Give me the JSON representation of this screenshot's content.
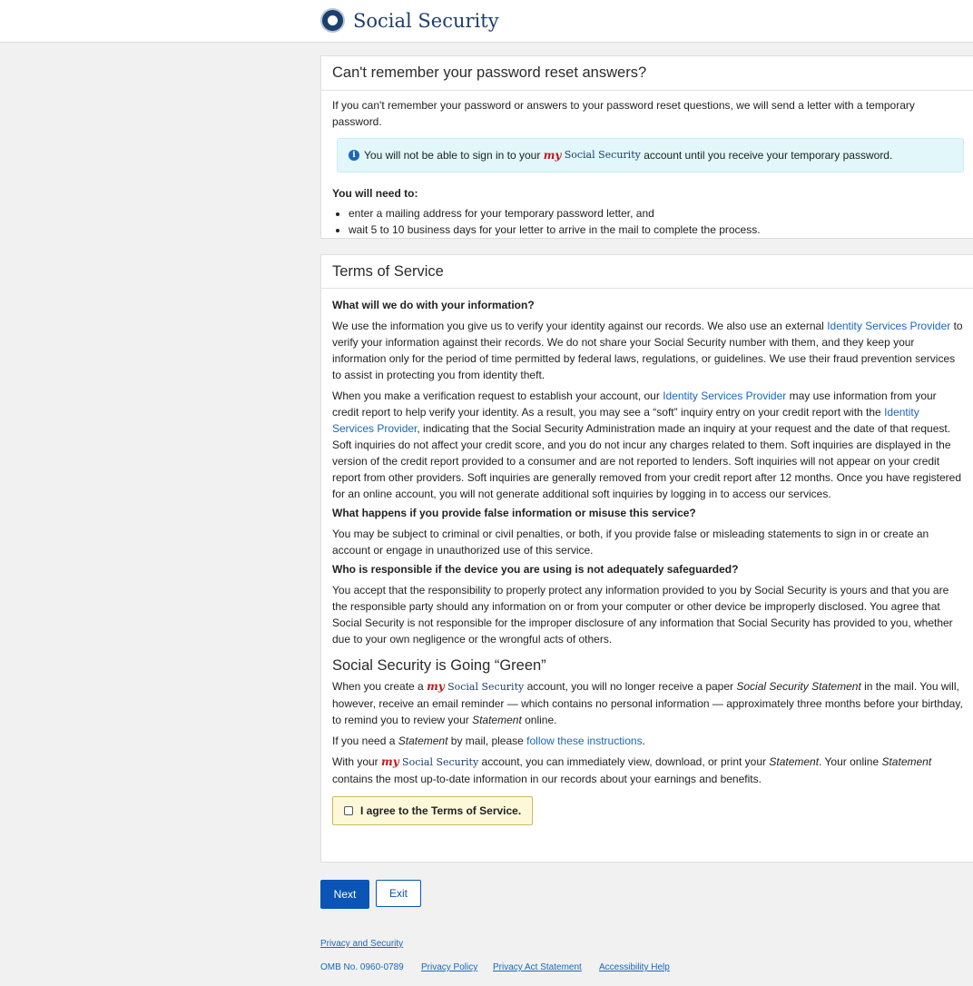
{
  "header": {
    "brand": "Social Security"
  },
  "reset_panel": {
    "title": "Can't remember your password reset answers?",
    "intro": "If you can't remember your password or answers to your password reset questions, we will send a letter with a temporary password.",
    "alert": {
      "before": "You will not be able to sign in to your",
      "my": "my",
      "ss": "Social Security",
      "after": "account until you receive your temporary password."
    },
    "need_heading": "You will need to:",
    "needs": [
      "enter a mailing address for your temporary password letter, and",
      "wait 5 to 10 business days for your letter to arrive in the mail to complete the process."
    ]
  },
  "terms_panel": {
    "title": "Terms of Service",
    "q1": "What will we do with your information?",
    "p1_a": "We use the information you give us to verify your identity against our records. We also use an external",
    "p1_link": "Identity Services Provider",
    "p1_b": "to verify your information against their records. We do not share your Social Security number with them, and they keep your information only for the period of time permitted by federal laws, regulations, or guidelines. We use their fraud prevention services to assist in protecting you from identity theft.",
    "p2_a": "When you make a verification request to establish your account, our",
    "p2_link1": "Identity Services Provider",
    "p2_b": "may use information from your credit report to help verify your identity. As a result, you may see a “soft” inquiry entry on your credit report with the",
    "p2_link2": "Identity Services Provider",
    "p2_c": ", indicating that the Social Security Administration made an inquiry at your request and the date of that request. Soft inquiries do not affect your credit score, and you do not incur any charges related to them. Soft inquiries are displayed in the version of the credit report provided to a consumer and are not reported to lenders. Soft inquiries will not appear on your credit report from other providers. Soft inquiries are generally removed from your credit report after 12 months. Once you have registered for an online account, you will not generate additional soft inquiries by logging in to access our services.",
    "q2": "What happens if you provide false information or misuse this service?",
    "p3": "You may be subject to criminal or civil penalties, or both, if you provide false or misleading statements to sign in or create an account or engage in unauthorized use of this service.",
    "q3": "Who is responsible if the device you are using is not adequately safeguarded?",
    "p4": "You accept that the responsibility to properly protect any information provided to you by Social Security is yours and that you are the responsible party should any information on or from your computer or other device be improperly disclosed. You agree that Social Security is not responsible for the improper disclosure of any information that Social Security has provided to you, whether due to your own negligence or the wrongful acts of others.",
    "green_title": "Social Security is Going “Green”",
    "g1_a": "When you create a",
    "my": "my",
    "ss": "Social Security",
    "g1_b": "account, you will no longer receive a paper",
    "g1_statement": "Social Security Statement",
    "g1_c": "in the mail. You will, however, receive an email reminder — which contains no personal information — approximately three months before your birthday, to remind you to review your",
    "g1_statement2": "Statement",
    "g1_d": "online.",
    "g2_a": "If you need a",
    "g2_statement": "Statement",
    "g2_b": "by mail, please",
    "g2_link": "follow these instructions",
    "g2_c": ".",
    "g3_a": "With your",
    "g3_b": "account, you can immediately view, download, or print your",
    "g3_statement": "Statement",
    "g3_c": ". Your online",
    "g3_statement2": "Statement",
    "g3_d": "contains the most up-to-date information in our records about your earnings and benefits.",
    "agree_label": "I agree to the Terms of Service."
  },
  "buttons": {
    "next": "Next",
    "exit": "Exit"
  },
  "footer": {
    "privacy_security": "Privacy and Security",
    "omb": "OMB No. 0960-0789",
    "privacy_policy": "Privacy Policy",
    "privacy_act": "Privacy Act Statement",
    "accessibility": "Accessibility Help"
  }
}
